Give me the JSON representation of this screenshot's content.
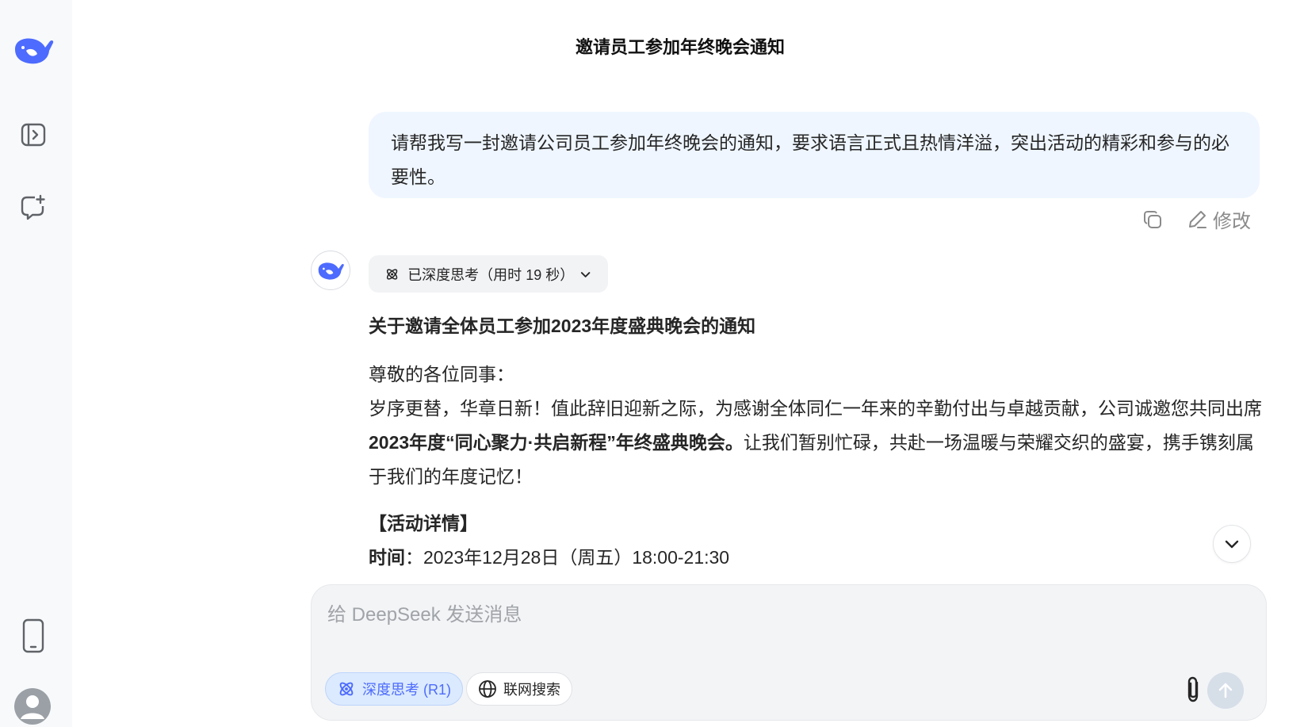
{
  "chat": {
    "title": "邀请员工参加年终晚会通知"
  },
  "user_message": {
    "text": "请帮我写一封邀请公司员工参加年终晚会的通知，要求语言正式且热情洋溢，突出活动的精彩和参与的必要性。",
    "actions": {
      "copy_icon": "copy-icon",
      "edit_label": "修改"
    }
  },
  "assistant_message": {
    "thinking_label": "已深度思考（用时 19 秒）",
    "heading": "关于邀请全体员工参加2023年度盛典晚会的通知",
    "greeting": "尊敬的各位同事：",
    "para1_start": "岁序更替，华章日新！值此辞旧迎新之际，为感谢全体同仁一年来的辛勤付出与卓越贡献，公司诚邀您共同出席",
    "para1_bold": "2023年度“同心聚力·共启新程”年终盛典晚会。",
    "para1_end": "让我们暂别忙碌，共赴一场温暖与荣耀交织的盛宴，携手镌刻属于我们的年度记忆！",
    "section_title": "【活动详情】",
    "time_label": "时间",
    "time_value": "：2023年12月28日（周五）18:00-21:30"
  },
  "composer": {
    "placeholder": "给 DeepSeek 发送消息",
    "deep_think_label": "深度思考 (R1)",
    "web_search_label": "联网搜索"
  },
  "colors": {
    "accent": "#4d6bfe",
    "user_bubble": "#eff6ff",
    "sidebar_bg": "#f8f9fb"
  }
}
